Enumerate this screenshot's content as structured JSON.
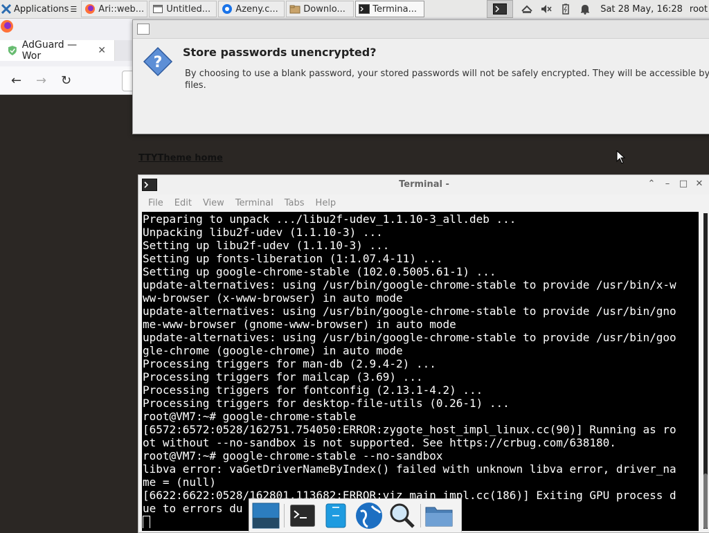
{
  "top_panel": {
    "applications_label": "Applications",
    "tasks": [
      {
        "label": "Ari::web...",
        "icon": "firefox-icon"
      },
      {
        "label": "Untitled...",
        "icon": "window-icon"
      },
      {
        "label": "Azeny.c...",
        "icon": "chromium-icon"
      },
      {
        "label": "Downlo...",
        "icon": "folder-icon"
      },
      {
        "label": "Termina...",
        "icon": "terminal-icon"
      }
    ],
    "clock": "Sat 28 May, 16:28",
    "user": "root"
  },
  "browser": {
    "tab_title": "AdGuard — Wor",
    "tab_close": "✕",
    "page_link": "TTYTheme home"
  },
  "dialog": {
    "heading": "Store passwords unencrypted?",
    "body": "By choosing to use a blank password, your stored passwords will not be safely encrypted. They will be accessible by\nfiles."
  },
  "terminal": {
    "title": "Terminal -",
    "menu": [
      "File",
      "Edit",
      "View",
      "Terminal",
      "Tabs",
      "Help"
    ],
    "lines": [
      "Preparing to unpack .../libu2f-udev_1.1.10-3_all.deb ...",
      "Unpacking libu2f-udev (1.1.10-3) ...",
      "Setting up libu2f-udev (1.1.10-3) ...",
      "Setting up fonts-liberation (1:1.07.4-11) ...",
      "Setting up google-chrome-stable (102.0.5005.61-1) ...",
      "update-alternatives: using /usr/bin/google-chrome-stable to provide /usr/bin/x-w",
      "ww-browser (x-www-browser) in auto mode",
      "update-alternatives: using /usr/bin/google-chrome-stable to provide /usr/bin/gno",
      "me-www-browser (gnome-www-browser) in auto mode",
      "update-alternatives: using /usr/bin/google-chrome-stable to provide /usr/bin/goo",
      "gle-chrome (google-chrome) in auto mode",
      "Processing triggers for man-db (2.9.4-2) ...",
      "Processing triggers for mailcap (3.69) ...",
      "Processing triggers for fontconfig (2.13.1-4.2) ...",
      "Processing triggers for desktop-file-utils (0.26-1) ...",
      "root@VM7:~# google-chrome-stable",
      "[6572:6572:0528/162751.754050:ERROR:zygote_host_impl_linux.cc(90)] Running as ro",
      "ot without --no-sandbox is not supported. See https://crbug.com/638180.",
      "root@VM7:~# google-chrome-stable --no-sandbox",
      "libva error: vaGetDriverNameByIndex() failed with unknown libva error, driver_na",
      "me = (null)",
      "[6622:6622:0528/162801.113682:ERROR:viz_main_impl.cc(186)] Exiting GPU process d",
      "ue to errors du"
    ]
  },
  "dock": {
    "items": [
      "show-desktop-icon",
      "terminal-icon",
      "file-manager-icon",
      "web-browser-icon",
      "search-icon",
      "folder-icon"
    ]
  },
  "colors": {
    "terminal_bg": "#000000",
    "terminal_fg": "#ffffff",
    "desktop_bg": "#2b2724",
    "dialog_bg": "#efefef"
  }
}
